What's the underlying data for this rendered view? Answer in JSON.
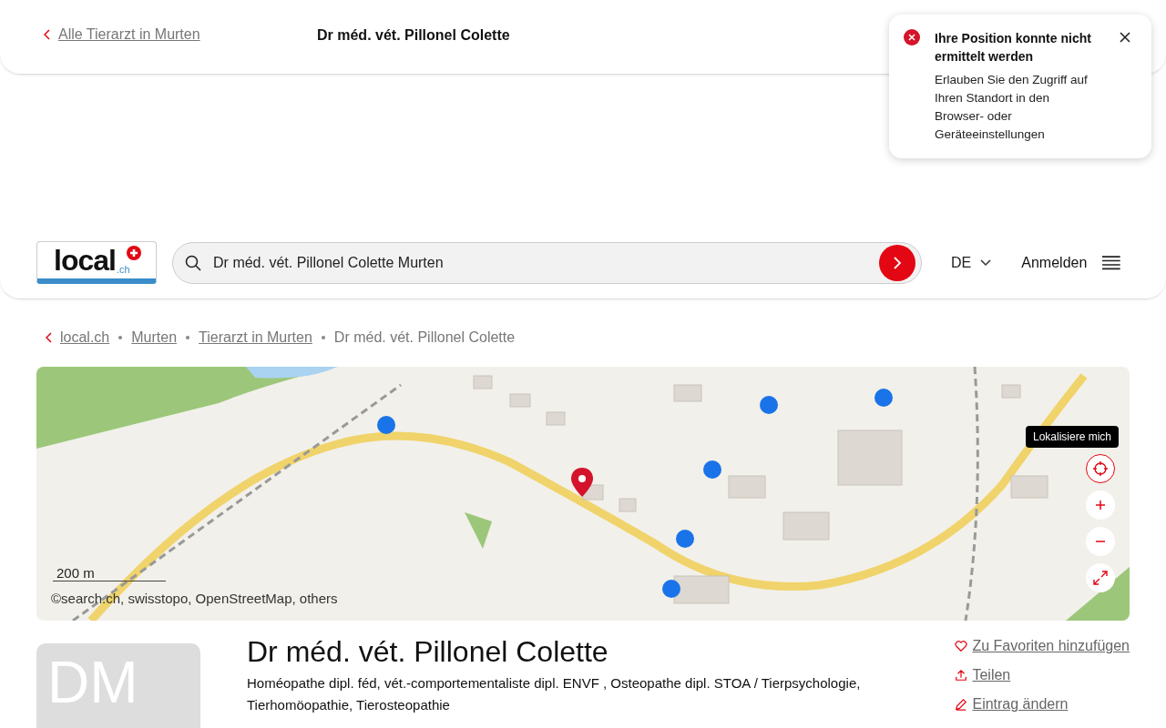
{
  "top_bar": {
    "back_link": "Alle Tierarzt in Murten",
    "title": "Dr méd. vét. Pillonel Colette"
  },
  "toast": {
    "title": "Ihre Position konnte nicht ermittelt werden",
    "message": "Erlauben Sie den Zugriff auf Ihren Standort in den Browser- oder Geräteeinstellungen"
  },
  "header": {
    "logo_text": "local",
    "logo_suffix": ".ch",
    "search": {
      "value": "Dr méd. vét. Pillonel Colette Murten"
    },
    "language": "DE",
    "login": "Anmelden"
  },
  "breadcrumb": [
    {
      "label": "local.ch",
      "link": true
    },
    {
      "label": "Murten",
      "link": true
    },
    {
      "label": "Tierarzt in Murten",
      "link": true
    },
    {
      "label": "Dr méd. vét. Pillonel Colette",
      "link": false
    }
  ],
  "map": {
    "tooltip": "Lokalisiere mich",
    "scale": "200 m",
    "attribution": "©search.ch, swisstopo, OpenStreetMap, others"
  },
  "entry": {
    "avatar_initials": "DM",
    "name": "Dr méd. vét. Pillonel Colette",
    "categories": "Homéopathe dipl. féd, vét.-comportementaliste dipl. ENVF , Osteopathe dipl. STOA / Tierpsychologie, Tierhomöopathie, Tierosteopathie",
    "actions": [
      {
        "kind": "favorite",
        "label": "Zu Favoriten hinzufügen"
      },
      {
        "kind": "share",
        "label": "Teilen"
      },
      {
        "kind": "edit",
        "label": "Eintrag ändern"
      }
    ]
  }
}
